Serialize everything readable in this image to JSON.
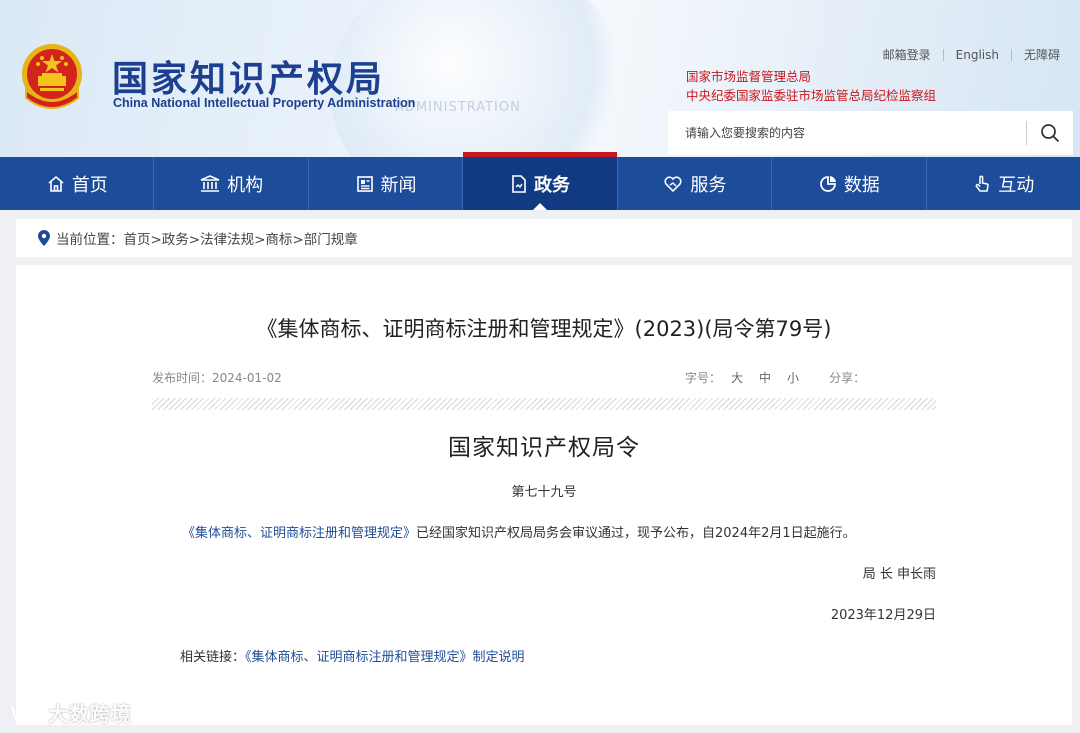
{
  "header": {
    "logo_cn": "国家知识产权局",
    "logo_en": "China National Intellectual Property Administration",
    "ghost_text": "ADMINISTRATION",
    "top_links": [
      "邮箱登录",
      "English",
      "无障碍"
    ],
    "supervisory_links": [
      "国家市场监督管理总局",
      "中央纪委国家监委驻市场监管总局纪检监察组"
    ],
    "search_placeholder": "请输入您要搜索的内容"
  },
  "nav": [
    {
      "label": "首页",
      "icon": "home-icon"
    },
    {
      "label": "机构",
      "icon": "institution-icon"
    },
    {
      "label": "新闻",
      "icon": "newspaper-icon"
    },
    {
      "label": "政务",
      "icon": "document-icon",
      "active": true
    },
    {
      "label": "服务",
      "icon": "heart-hand-icon"
    },
    {
      "label": "数据",
      "icon": "pie-chart-icon"
    },
    {
      "label": "互动",
      "icon": "hand-pointer-icon"
    }
  ],
  "breadcrumb": "当前位置：首页>政务>法律法规>商标>部门规章",
  "article": {
    "title": "《集体商标、证明商标注册和管理规定》(2023)(局令第79号)",
    "publish_label": "发布时间：2024-01-02",
    "font_size_label": "字号：",
    "font_sizes": [
      "大",
      "中",
      "小"
    ],
    "share_label": "分享：",
    "doc_title": "国家知识产权局令",
    "order_no": "第七十九号",
    "body_link": "《集体商标、证明商标注册和管理规定》",
    "body_rest": "已经国家知识产权局局务会审议通过，现予公布，自2024年2月1日起施行。",
    "signer": "局 长  申长雨",
    "date": "2023年12月29日",
    "related_label": "相关链接：",
    "related_link": "《集体商标、证明商标注册和管理规定》制定说明"
  },
  "watermark": "大数跨境",
  "colors": {
    "brand_blue": "#1d4c9a",
    "accent_red": "#c8161d",
    "link_blue": "#1f4e95"
  }
}
